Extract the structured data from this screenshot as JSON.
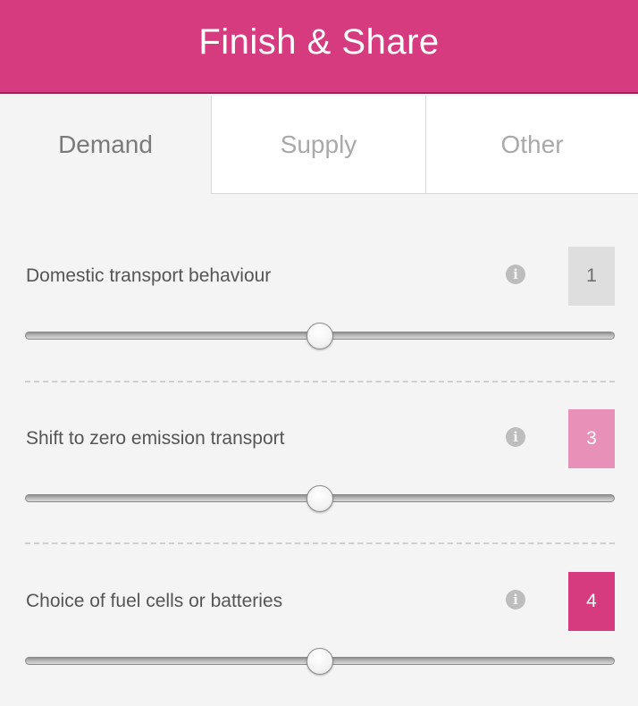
{
  "header": {
    "title": "Finish & Share",
    "color": "#d63b7f"
  },
  "tabs": [
    {
      "label": "Demand",
      "active": true
    },
    {
      "label": "Supply",
      "active": false
    },
    {
      "label": "Other",
      "active": false
    }
  ],
  "levers": [
    {
      "label": "Domestic transport behaviour",
      "value": "1",
      "box_color": "#dedede",
      "value_text_color": "#6e6e6e",
      "slider_fraction": 0.5,
      "info_icon": "info-icon"
    },
    {
      "label": "Shift to zero emission transport",
      "value": "3",
      "box_color": "#e791b8",
      "value_text_color": "#ffffff",
      "slider_fraction": 0.5,
      "info_icon": "info-icon"
    },
    {
      "label": "Choice of fuel cells or batteries",
      "value": "4",
      "box_color": "#d63b7f",
      "value_text_color": "#ffffff",
      "slider_fraction": 0.5,
      "info_icon": "info-icon"
    }
  ]
}
